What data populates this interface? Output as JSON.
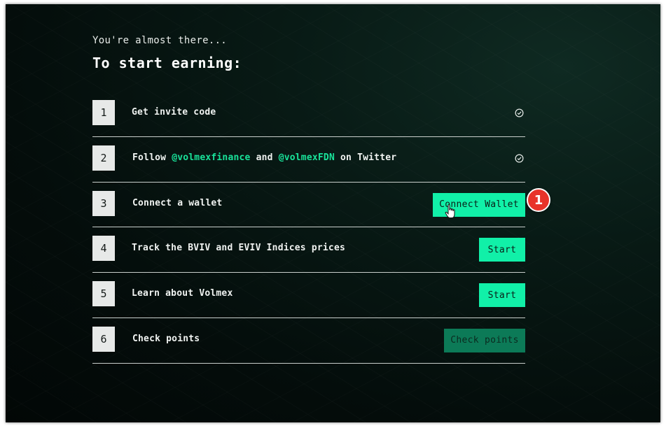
{
  "header": {
    "subtitle": "You're almost there...",
    "title": "To start earning:"
  },
  "steps": [
    {
      "number": "1",
      "label": "Get invite code",
      "status": "check-circle-icon"
    },
    {
      "number": "2",
      "label_prefix": "Follow ",
      "handle1": "@volmexfinance",
      "label_mid": " and ",
      "handle2": "@volmexFDN",
      "label_suffix": " on Twitter",
      "status": "check-circle-icon"
    },
    {
      "number": "3",
      "label": "Connect a wallet",
      "button": "Connect Wallet"
    },
    {
      "number": "4",
      "label": "Track the BVIV and EVIV Indices prices",
      "button": "Start"
    },
    {
      "number": "5",
      "label": "Learn about Volmex",
      "button": "Start"
    },
    {
      "number": "6",
      "label": "Check points",
      "button": "Check points"
    }
  ],
  "annotation": {
    "badge": "1"
  },
  "colors": {
    "accent": "#11f0a8",
    "accent_dark": "#0c7a57",
    "handle": "#19e39a",
    "badge": "#e8332a"
  }
}
